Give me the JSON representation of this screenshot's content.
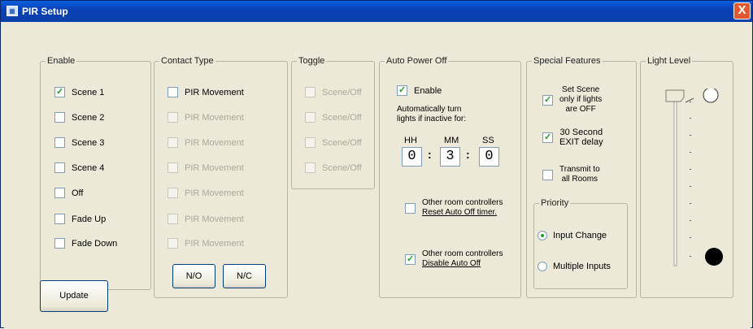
{
  "window": {
    "title": "PIR Setup",
    "close_glyph": "X"
  },
  "enable": {
    "legend": "Enable",
    "items": [
      {
        "label": "Scene 1",
        "checked": true
      },
      {
        "label": "Scene 2",
        "checked": false
      },
      {
        "label": "Scene 3",
        "checked": false
      },
      {
        "label": "Scene 4",
        "checked": false
      },
      {
        "label": "Off",
        "checked": false
      },
      {
        "label": "Fade Up",
        "checked": false
      },
      {
        "label": "Fade Down",
        "checked": false
      }
    ]
  },
  "update_button": "Update",
  "contact_type": {
    "legend": "Contact Type",
    "items": [
      "PIR Movement",
      "PIR Movement",
      "PIR Movement",
      "PIR Movement",
      "PIR Movement",
      "PIR Movement",
      "PIR Movement"
    ],
    "no_button": "N/O",
    "nc_button": "N/C"
  },
  "toggle": {
    "legend": "Toggle",
    "items": [
      "Scene/Off",
      "Scene/Off",
      "Scene/Off",
      "Scene/Off"
    ]
  },
  "auto_power_off": {
    "legend": "Auto Power Off",
    "enable_label": "Enable",
    "enable_checked": true,
    "desc_line1": "Automatically turn",
    "desc_line2": "lights if inactive for:",
    "hh_label": "HH",
    "mm_label": "MM",
    "ss_label": "SS",
    "hh": "0",
    "mm": "3",
    "ss": "0",
    "sep": ":",
    "reset_line1": "Other room controllers",
    "reset_line2": "Reset Auto Off timer.",
    "reset_checked": false,
    "disable_line1": "Other room controllers",
    "disable_line2": "Disable Auto Off",
    "disable_checked": true
  },
  "special_features": {
    "legend": "Special Features",
    "set_scene": [
      "Set Scene",
      "only if lights",
      "are OFF"
    ],
    "set_scene_checked": true,
    "exit_delay": [
      "30 Second",
      "EXIT delay"
    ],
    "exit_checked": true,
    "transmit": [
      "Transmit to",
      "all Rooms"
    ],
    "transmit_checked": false
  },
  "priority": {
    "legend": "Priority",
    "options": [
      "Input Change",
      "Multiple Inputs"
    ],
    "selected": "Input Change"
  },
  "light_level": {
    "legend": "Light Level",
    "level": 1.0
  }
}
